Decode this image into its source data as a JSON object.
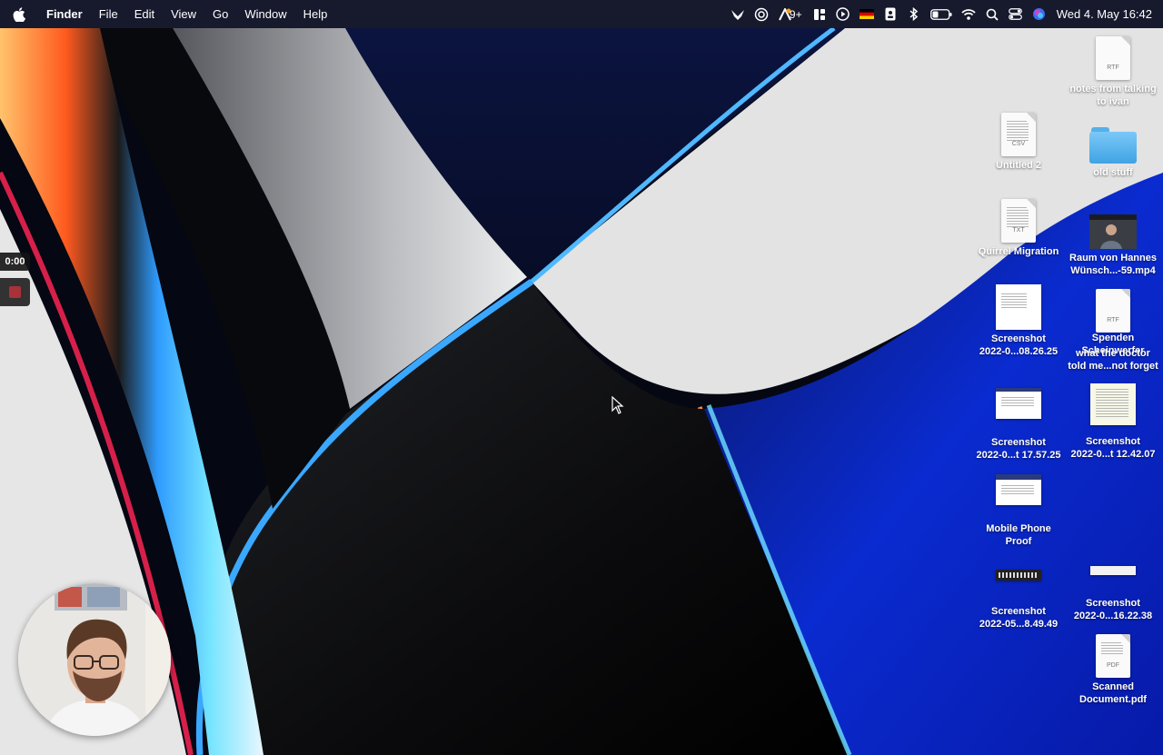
{
  "menubar": {
    "app_name": "Finder",
    "menus": [
      "File",
      "Edit",
      "View",
      "Go",
      "Window",
      "Help"
    ],
    "notification_count": "9+",
    "datetime": "Wed 4. May  16:42",
    "status_icons": [
      "bird-icon",
      "focus-icon",
      "a-badge-icon",
      "layout-icon",
      "play-icon",
      "german-flag-icon",
      "contact-icon",
      "bluetooth-icon",
      "battery-icon",
      "wifi-icon",
      "search-icon",
      "control-center-icon",
      "siri-icon"
    ]
  },
  "recorder": {
    "timer": "0:00"
  },
  "desktop_icons": [
    {
      "label_lines": [
        "notes from talking",
        "to ivan"
      ],
      "kind": "document",
      "ext": "RTF"
    },
    {
      "label_lines": [
        "Untitled 2"
      ],
      "kind": "document",
      "ext": "CSV"
    },
    {
      "label_lines": [
        "old stuff"
      ],
      "kind": "folder"
    },
    {
      "label_lines": [
        "Quirrel Migration"
      ],
      "kind": "document",
      "ext": "TXT"
    },
    {
      "label_lines": [
        "Raum von Hannes",
        "Wünsch...-59.mp4"
      ],
      "kind": "video"
    },
    {
      "label_lines": [
        "Screenshot",
        "2022-0...08.26.25"
      ],
      "kind": "screenshot"
    },
    {
      "label_lines": [
        "Spenden",
        "Scheinwerfer"
      ],
      "kind": "document",
      "ext": "RTF"
    },
    {
      "label_lines": [
        "what the doctor",
        "told me...not forget"
      ],
      "kind": "document"
    },
    {
      "label_lines": [
        "Screenshot",
        "2022-0...t 17.57.25"
      ],
      "kind": "screenshot"
    },
    {
      "label_lines": [
        "Screenshot",
        "2022-0...t 12.42.07"
      ],
      "kind": "screenshot"
    },
    {
      "label_lines": [
        "Mobile Phone",
        "Proof"
      ],
      "kind": "screenshot"
    },
    {
      "label_lines": [
        "Screenshot",
        "2022-05...8.49.49"
      ],
      "kind": "screenshot"
    },
    {
      "label_lines": [
        "Screenshot",
        "2022-0...16.22.38"
      ],
      "kind": "screenshot"
    },
    {
      "label_lines": [
        "Scanned",
        "Document.pdf"
      ],
      "kind": "document",
      "ext": "PDF"
    }
  ],
  "colors": {
    "menubar_bg": "#191c30",
    "folder_blue": "#4fb0ee",
    "record_red": "#a8313a"
  }
}
